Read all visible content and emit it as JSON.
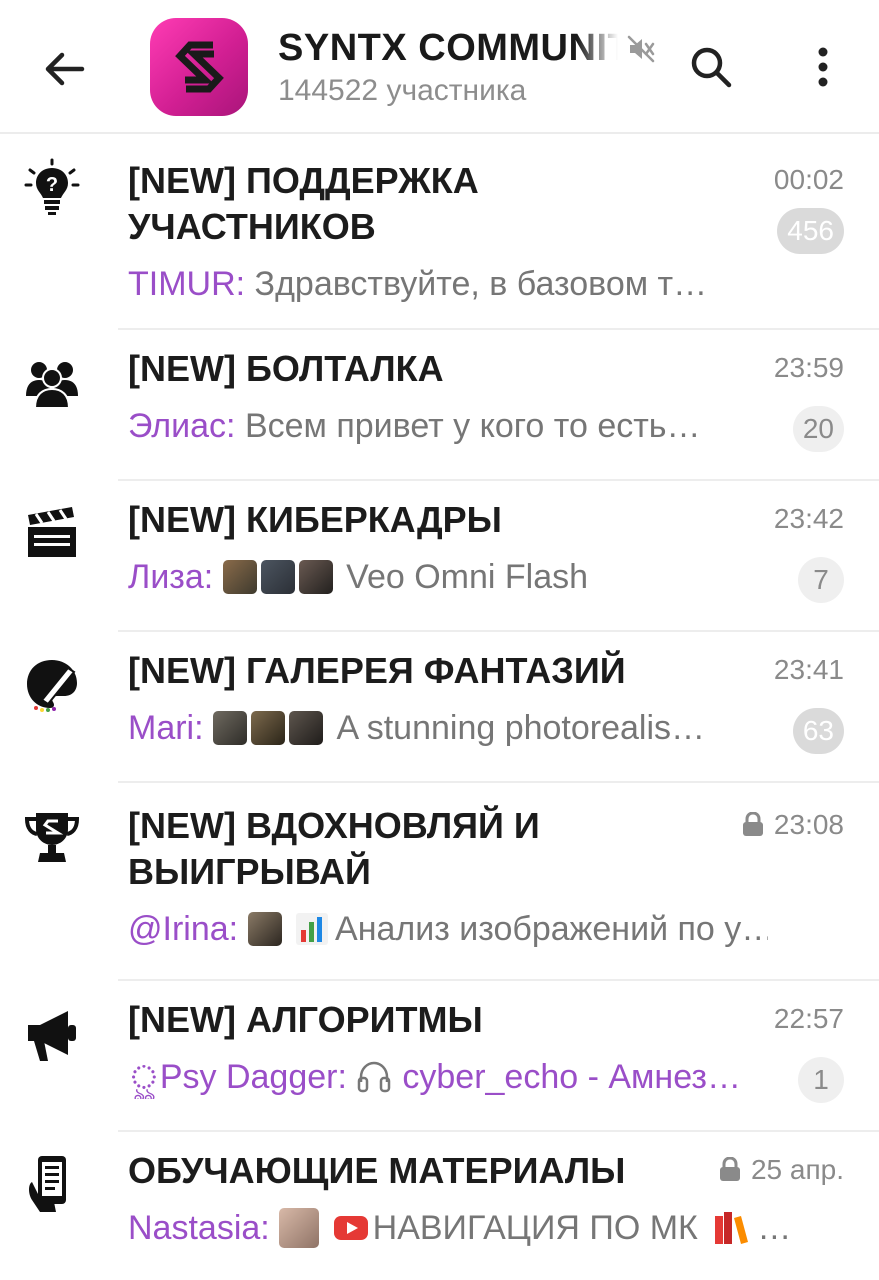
{
  "header": {
    "title": "SYNTX COMMUNITY",
    "subtitle": "144522 участника"
  },
  "chats": [
    {
      "icon": "lightbulb-question-icon",
      "name": "[NEW] ПОДДЕРЖКА УЧАСТНИКОВ",
      "time": "00:02",
      "sender": "TIMUR:",
      "preview": "Здравствуйте, в базовом т…",
      "unread": "456",
      "badge_style": "gray"
    },
    {
      "icon": "people-group-icon",
      "name": "[NEW] БОЛТАЛКА",
      "time": "23:59",
      "sender": "Элиас:",
      "preview": "Всем привет у кого то есть…",
      "unread": "20",
      "badge_style": "light"
    },
    {
      "icon": "clapperboard-icon",
      "name": "[NEW] КИБЕРКАДРЫ",
      "time": "23:42",
      "sender": "Лиза:",
      "preview": "Veo Omni Flash",
      "unread": "7",
      "badge_style": "light"
    },
    {
      "icon": "palette-brush-icon",
      "name": "[NEW] ГАЛЕРЕЯ ФАНТАЗИЙ",
      "time": "23:41",
      "sender": "Mari:",
      "preview": "A stunning photorealis…",
      "unread": "63",
      "badge_style": "gray"
    },
    {
      "icon": "trophy-icon",
      "name": "[NEW] ВДОХНОВЛЯЙ И ВЫИГРЫВАЙ",
      "time": "23:08",
      "sender": "@Irina:",
      "preview": "Анализ изображений по у…",
      "unread": "",
      "badge_style": "none"
    },
    {
      "icon": "megaphone-icon",
      "name": "[NEW] АЛГОРИТМЫ",
      "time": "22:57",
      "sender": "ৣPsy Dagger:",
      "preview": "cyber_echo - Амнез…",
      "unread": "1",
      "badge_style": "light"
    },
    {
      "icon": "phone-hand-icon",
      "name": "ОБУЧАЮЩИЕ МАТЕРИАЛЫ",
      "time": "25 апр.",
      "sender": "Nastasia:",
      "preview": "НАВИГАЦИЯ ПО МК",
      "unread": "",
      "badge_style": "none"
    }
  ],
  "colors": {
    "accent_purple": "#9a4ec8",
    "avatar_pink": "#e0259c",
    "badge_gray": "#dadada",
    "badge_light": "#efefef"
  }
}
